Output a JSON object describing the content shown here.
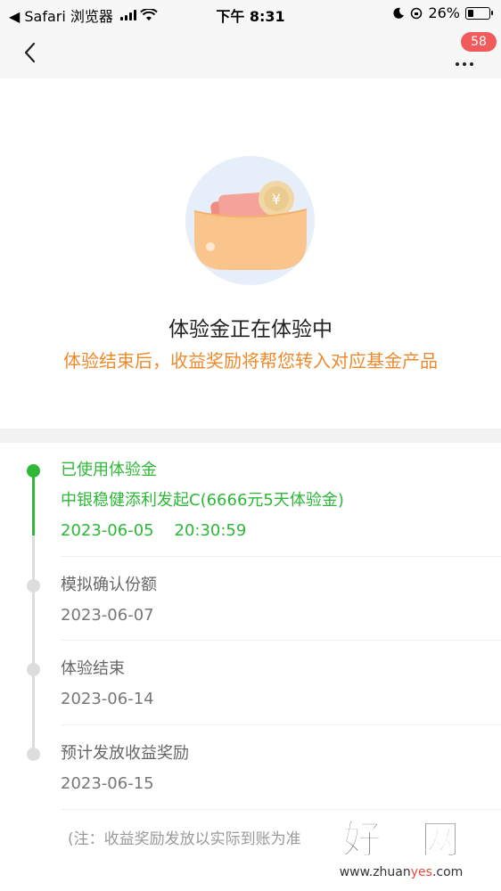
{
  "status_bar": {
    "back_app": "◀ Safari 浏览器",
    "time": "下午 8:31",
    "battery": "26%"
  },
  "nav": {
    "badge_count": "58"
  },
  "hero": {
    "title": "体验金正在体验中",
    "description": "体验结束后，收益奖励将帮您转入对应基金产品",
    "accent_color": "#ee8a2c"
  },
  "timeline": {
    "steps": [
      {
        "title": "已使用体验金",
        "subtitle": "中银稳健添利发起C(6666元5天体验金)",
        "date": "2023-06-05    20:30:59",
        "status": "done"
      },
      {
        "title": "模拟确认份额",
        "date": "2023-06-07",
        "status": "pending"
      },
      {
        "title": "体验结束",
        "date": "2023-06-14",
        "status": "pending"
      },
      {
        "title": "预计发放收益奖励",
        "date": "2023-06-15",
        "status": "pending"
      }
    ],
    "note": "(注：收益奖励发放以实际到账为准",
    "active_color": "#2db838"
  },
  "watermark": {
    "text": "好赚网",
    "url": "www.zhuanyes.com"
  }
}
